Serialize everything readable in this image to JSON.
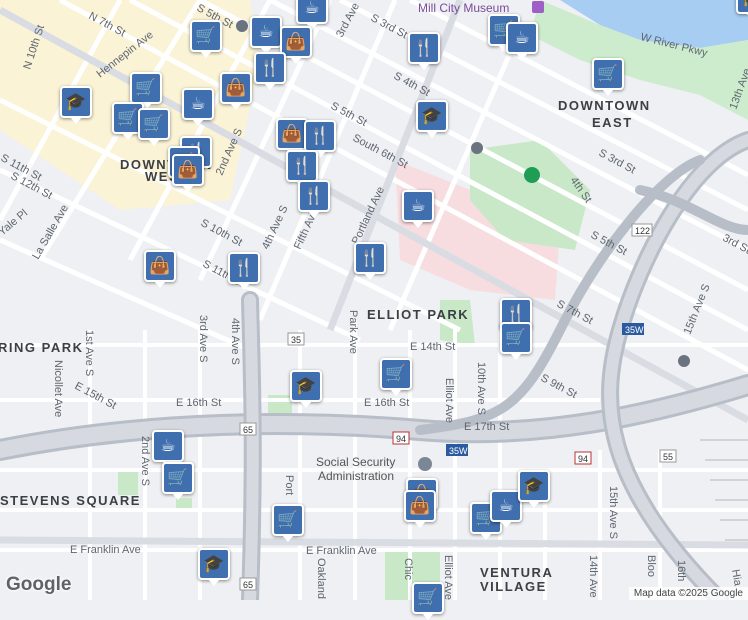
{
  "map": {
    "attribution": "Map data ©2025 Google",
    "logo": "Google",
    "neighborhoods": [
      "DOWNTOWN",
      "EAST",
      "DOWNTOWN",
      "WEST",
      "ELLIOT PARK",
      "STEVENS SQUARE",
      "VENTURA",
      "VILLAGE",
      "RING PARK"
    ],
    "pois": [
      "Mill City Museum",
      "Social Security",
      "Administration"
    ],
    "streets": [
      "N 7th St",
      "N 10th St",
      "S 5th St",
      "Hennepin Ave",
      "3rd Ave",
      "S 3rd St",
      "S 4th St",
      "W River Pkwy",
      "S 5th St",
      "South 6th St",
      "S 11th St",
      "S 12th St",
      "S 10th St",
      "4th Ave S",
      "Fifth Ave",
      "Portland Ave",
      "La Salle Ave",
      "Yale Pl",
      "2nd Ave S",
      "S 11th St",
      "S 3rd St",
      "4th St",
      "S 5th St",
      "3rd St",
      "S 7th St",
      "15th Ave S",
      "13th Ave",
      "1st Ave S",
      "3rd Ave S",
      "4th Ave S",
      "Park Ave",
      "E 14th St",
      "E 16th St",
      "E 16th St",
      "E 17th St",
      "Nicollet Ave",
      "E 15th St",
      "2nd Ave S",
      "Elliot Ave",
      "10th Ave S",
      "S 9th St",
      "E Franklin Ave",
      "E Franklin Ave",
      "Oakland",
      "Port",
      "Chic",
      "Elliot Ave",
      "14th Ave",
      "15th Ave S",
      "Bloo",
      "16th",
      "Hia"
    ],
    "shields": [
      "35",
      "65",
      "94",
      "35W",
      "94",
      "35W",
      "122",
      "55",
      "65"
    ]
  },
  "markers": [
    {
      "icon": "cafe-icon",
      "glyph": "☕"
    },
    {
      "icon": "shopping-cart-icon",
      "glyph": "🛒"
    },
    {
      "icon": "cafe-icon",
      "glyph": "☕"
    },
    {
      "icon": "shopping-bag-icon",
      "glyph": "👜"
    },
    {
      "icon": "restaurant-icon",
      "glyph": "🍴"
    },
    {
      "icon": "restaurant-icon",
      "glyph": "🍴"
    },
    {
      "icon": "shopping-cart-icon",
      "glyph": "🛒"
    },
    {
      "icon": "cafe-icon",
      "glyph": "☕"
    },
    {
      "icon": "shopping-cart-icon",
      "glyph": "🛒"
    },
    {
      "icon": "school-icon",
      "glyph": "🎓"
    },
    {
      "icon": "shopping-cart-icon",
      "glyph": "🛒"
    },
    {
      "icon": "cafe-icon",
      "glyph": "☕"
    },
    {
      "icon": "shopping-bag-icon",
      "glyph": "👜"
    },
    {
      "icon": "shopping-cart-icon",
      "glyph": "🛒"
    },
    {
      "icon": "shopping-cart-icon",
      "glyph": "🛒"
    },
    {
      "icon": "school-icon",
      "glyph": "🎓"
    },
    {
      "icon": "shopping-bag-icon",
      "glyph": "👜"
    },
    {
      "icon": "restaurant-icon",
      "glyph": "🍴"
    },
    {
      "icon": "restaurant-icon",
      "glyph": "🍴"
    },
    {
      "icon": "restaurant-icon",
      "glyph": "🍴"
    },
    {
      "icon": "shopping-cart-icon",
      "glyph": "🛒"
    },
    {
      "icon": "shopping-bag-icon",
      "glyph": "👜"
    },
    {
      "icon": "restaurant-icon",
      "glyph": "🍴"
    },
    {
      "icon": "cafe-icon",
      "glyph": "☕"
    },
    {
      "icon": "restaurant-icon",
      "glyph": "🍴"
    },
    {
      "icon": "shopping-bag-icon",
      "glyph": "👜"
    },
    {
      "icon": "restaurant-icon",
      "glyph": "🍴"
    },
    {
      "icon": "restaurant-icon",
      "glyph": "🍴"
    },
    {
      "icon": "shopping-cart-icon",
      "glyph": "🛒"
    },
    {
      "icon": "shopping-cart-icon",
      "glyph": "🛒"
    },
    {
      "icon": "school-icon",
      "glyph": "🎓"
    },
    {
      "icon": "cafe-icon",
      "glyph": "☕"
    },
    {
      "icon": "shopping-cart-icon",
      "glyph": "🛒"
    },
    {
      "icon": "shopping-bag-icon",
      "glyph": "👜"
    },
    {
      "icon": "shopping-bag-icon",
      "glyph": "👜"
    },
    {
      "icon": "shopping-cart-icon",
      "glyph": "🛒"
    },
    {
      "icon": "cafe-icon",
      "glyph": "☕"
    },
    {
      "icon": "school-icon",
      "glyph": "🎓"
    },
    {
      "icon": "shopping-cart-icon",
      "glyph": "🛒"
    },
    {
      "icon": "school-icon",
      "glyph": "🎓"
    },
    {
      "icon": "shopping-cart-icon",
      "glyph": "🛒"
    },
    {
      "icon": "school-icon",
      "glyph": "🎓"
    }
  ]
}
